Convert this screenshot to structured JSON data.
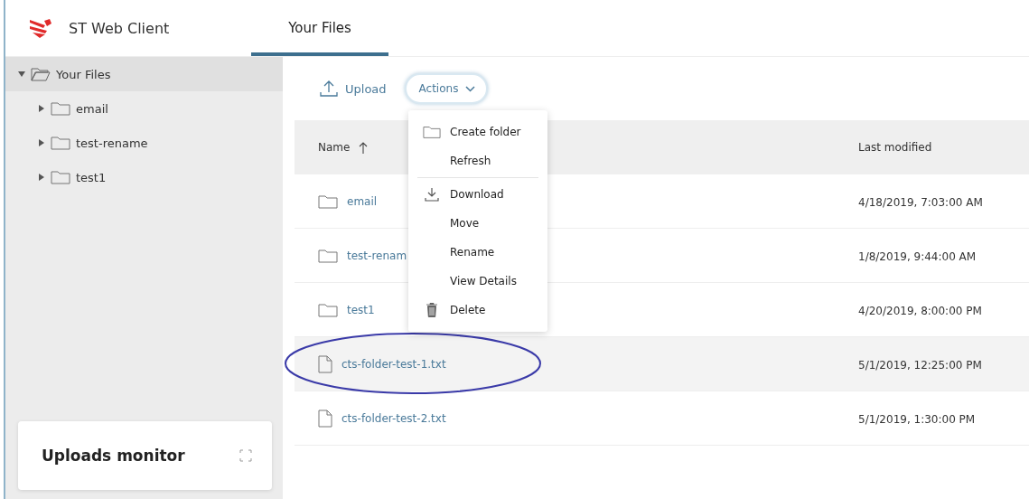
{
  "app": {
    "title": "ST Web Client"
  },
  "tabs": [
    {
      "label": "Your Files",
      "selected": true
    }
  ],
  "tree": {
    "label": "Your Files",
    "expanded": true,
    "selected": true,
    "children": [
      {
        "label": "email",
        "expanded": false,
        "selected": false
      },
      {
        "label": "test-rename",
        "expanded": false,
        "selected": false
      },
      {
        "label": "test1",
        "expanded": false,
        "selected": false
      }
    ]
  },
  "toolbar": {
    "upload": "Upload",
    "actions": "Actions"
  },
  "actions_menu": {
    "open": true,
    "groups": [
      [
        {
          "label": "Create folder",
          "kind": "create"
        },
        {
          "label": "Refresh",
          "kind": "plain"
        }
      ],
      [
        {
          "label": "Download",
          "kind": "download"
        },
        {
          "label": "Move",
          "kind": "plain"
        },
        {
          "label": "Rename",
          "kind": "plain"
        },
        {
          "label": "View Details",
          "kind": "plain"
        },
        {
          "label": "Delete",
          "kind": "delete"
        }
      ]
    ]
  },
  "table": {
    "columns": [
      "Name",
      "Last modified"
    ],
    "rows": [
      {
        "kind": "folder",
        "name": "email",
        "modified": "4/18/2019, 7:03:00 AM",
        "selected": false
      },
      {
        "kind": "folder",
        "name": "test-renam",
        "modified": "1/8/2019, 9:44:00 AM",
        "selected": false
      },
      {
        "kind": "folder",
        "name": "test1",
        "modified": "4/20/2019, 8:00:00 PM",
        "selected": false
      },
      {
        "kind": "file",
        "name": "cts-folder-test-1.txt",
        "modified": "5/1/2019, 12:25:00 PM",
        "selected": true,
        "circled": true
      },
      {
        "kind": "file",
        "name": "cts-folder-test-2.txt",
        "modified": "5/1/2019, 1:30:00 PM",
        "selected": false,
        "circled": false
      }
    ]
  },
  "uploads_monitor": {
    "title": "Uploads monitor"
  }
}
